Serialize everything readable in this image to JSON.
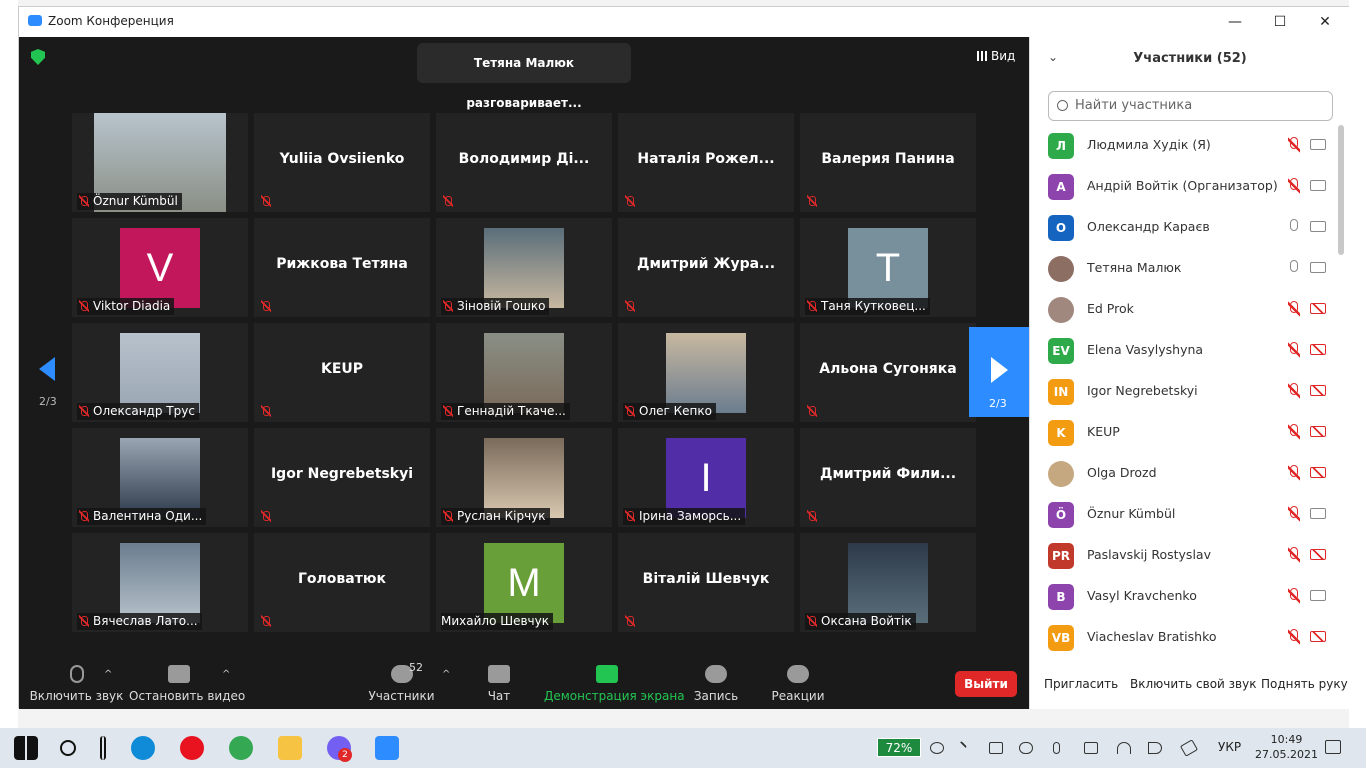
{
  "window": {
    "title": "Zoom Конференция"
  },
  "banner": "Тетяна Малюк разговаривает...",
  "view_label": "Вид",
  "page_indicator": "2/3",
  "tiles": [
    {
      "type": "video",
      "name": "Öznur Kümbül"
    },
    {
      "type": "name",
      "name": "Yuliia Ovsiienko"
    },
    {
      "type": "name",
      "name": "Володимир  Ді..."
    },
    {
      "type": "name",
      "name": "Наталія Рожел..."
    },
    {
      "type": "name",
      "name": "Валерия Панина"
    },
    {
      "type": "letter",
      "letter": "V",
      "color": "#c2185b",
      "name": "Viktor Diadia"
    },
    {
      "type": "name",
      "name": "Рижкова Тетяна"
    },
    {
      "type": "video",
      "name": "Зіновій Гошко"
    },
    {
      "type": "name",
      "name": "Дмитрий  Жура..."
    },
    {
      "type": "letter",
      "letter": "T",
      "color": "#78909c",
      "name": "Таня Кутковец..."
    },
    {
      "type": "video",
      "name": "Олександр Трус"
    },
    {
      "type": "name",
      "name": "KEUP"
    },
    {
      "type": "video",
      "name": "Геннадій Ткаче..."
    },
    {
      "type": "video",
      "name": "Олег Кепко"
    },
    {
      "type": "name",
      "name": "Альона Сугоняка"
    },
    {
      "type": "video",
      "name": "Валентина Оди..."
    },
    {
      "type": "name",
      "name": "Igor Negrebetskyi"
    },
    {
      "type": "video",
      "name": "Руслан Кірчук"
    },
    {
      "type": "letter",
      "letter": "I",
      "color": "#512da8",
      "name": "Ірина Заморсь..."
    },
    {
      "type": "name",
      "name": "Дмитрий  Фили..."
    },
    {
      "type": "video",
      "name": "Вячеслав Лато..."
    },
    {
      "type": "name",
      "name": "Головатюк"
    },
    {
      "type": "letter",
      "letter": "M",
      "color": "#689f38",
      "name": "Михайло Шевчук"
    },
    {
      "type": "name",
      "name": "Віталій Шевчук"
    },
    {
      "type": "video",
      "name": "Оксана Войтік"
    }
  ],
  "toolbar": {
    "audio": "Включить звук",
    "video": "Остановить видео",
    "participants": "Участники",
    "participants_count": "52",
    "chat": "Чат",
    "share": "Демонстрация экрана",
    "record": "Запись",
    "reactions": "Реакции",
    "leave": "Выйти"
  },
  "panel": {
    "title": "Участники (52)",
    "search_placeholder": "Найти участника",
    "invite": "Пригласить",
    "unmute_self": "Включить свой звук",
    "raise_hand": "Поднять руку",
    "participants": [
      {
        "initials": "Л",
        "color": "#2eaa4b",
        "name": "Людмила Худік (Я)",
        "mic": "off",
        "cam": "on"
      },
      {
        "initials": "А",
        "color": "#8e44ad",
        "name": "Андрій Войтік (Организатор)",
        "mic": "off",
        "cam": "on"
      },
      {
        "initials": "О",
        "color": "#1565c0",
        "name": "Олександр Караєв",
        "mic": "on",
        "cam": "on"
      },
      {
        "initials": "",
        "color": "#8d6e63",
        "name": "Тетяна Малюк",
        "mic": "on",
        "cam": "on"
      },
      {
        "initials": "",
        "color": "#a1887f",
        "name": "Ed Prok",
        "mic": "off",
        "cam": "off"
      },
      {
        "initials": "EV",
        "color": "#2eaa4b",
        "name": "Elena Vasylyshyna",
        "mic": "off",
        "cam": "off"
      },
      {
        "initials": "IN",
        "color": "#f39c12",
        "name": "Igor Negrebetskyi",
        "mic": "off",
        "cam": "off"
      },
      {
        "initials": "K",
        "color": "#f39c12",
        "name": "KEUP",
        "mic": "off",
        "cam": "off"
      },
      {
        "initials": "",
        "color": "#c5a880",
        "name": "Olga Drozd",
        "mic": "off",
        "cam": "off"
      },
      {
        "initials": "Ö",
        "color": "#8e44ad",
        "name": "Öznur Kümbül",
        "mic": "off",
        "cam": "on"
      },
      {
        "initials": "PR",
        "color": "#c0392b",
        "name": "Paslavskij Rostyslav",
        "mic": "off",
        "cam": "off"
      },
      {
        "initials": "B",
        "color": "#8e44ad",
        "name": "Vasyl Kravchenko",
        "mic": "off",
        "cam": "on"
      },
      {
        "initials": "VB",
        "color": "#f39c12",
        "name": "Viacheslav Bratishko",
        "mic": "off",
        "cam": "off"
      }
    ]
  },
  "taskbar": {
    "battery": "72%",
    "lang": "УКР",
    "time": "10:49",
    "date": "27.05.2021",
    "badge": "2"
  }
}
